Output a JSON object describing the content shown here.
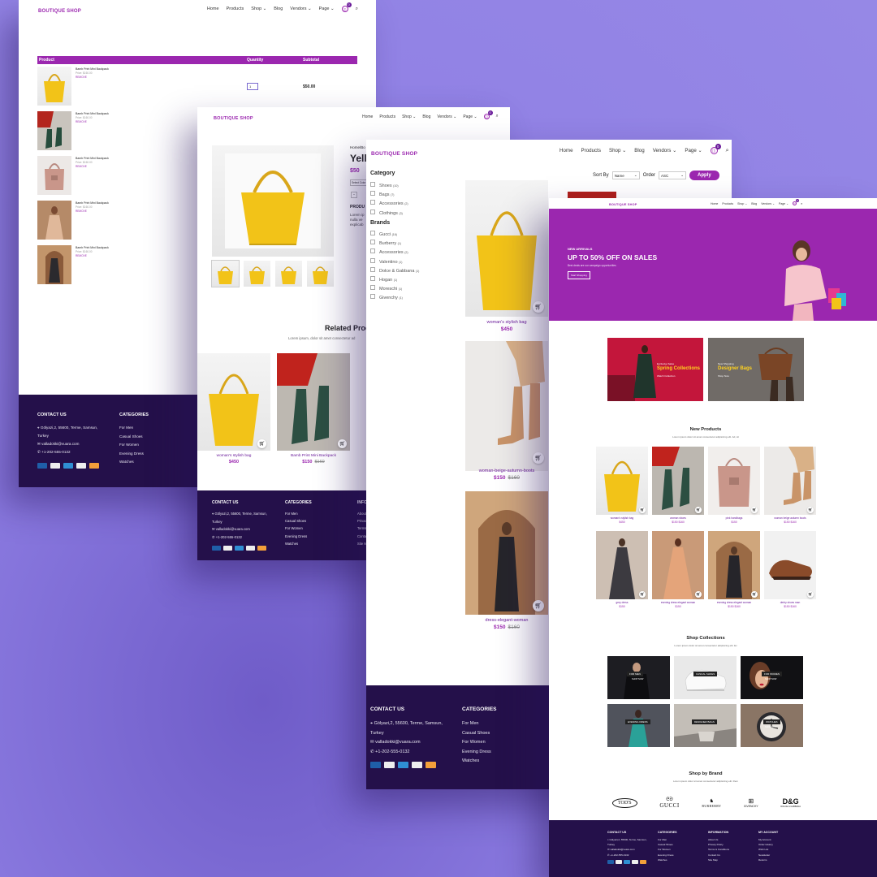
{
  "brand": "BOUTIQUE SHOP",
  "nav": {
    "home": "Home",
    "products": "Products",
    "shop": "Shop",
    "blog": "Blog",
    "vendors": "Vendors",
    "page": "Page",
    "cart_count": "0"
  },
  "cart": {
    "headers": {
      "product": "Product",
      "quantity": "Quantity",
      "subtotal": "Subtotal"
    },
    "items": [
      {
        "name": "Bamb Print Mini Backpack",
        "price": "Price: $160.00",
        "remove": "REMOVE"
      },
      {
        "name": "Bamb Print Mini Backpack",
        "price": "Price: $160.00",
        "remove": "REMOVE"
      },
      {
        "name": "Bamb Print Mini Backpack",
        "price": "Price: $160.00",
        "remove": "REMOVE"
      },
      {
        "name": "Bamb Print Mini Backpack",
        "price": "Price: $160.00",
        "remove": "REMOVE"
      },
      {
        "name": "Bamb Print Mini Backpack",
        "price": "Price: $160.00",
        "remove": "REMOVE"
      }
    ],
    "quantity": "1",
    "subtotal": "$50.00"
  },
  "footer": {
    "contact_title": "CONTACT US",
    "address_line1": "Gölyazi,2, 55600, Terme, Samsun,",
    "address_line2": "Turkey",
    "email": "valladokki@vuara.com",
    "phone": "+1-202-555-0132",
    "categories_title": "CATEGORIES",
    "categories": [
      "For Men",
      "Casual Shoes",
      "For Women",
      "Evening Dress",
      "Watches"
    ],
    "info_title": "INFORMATION",
    "info_links": [
      "About Us",
      "Privacy Policy",
      "Terms & Conditions",
      "Contact Us",
      "Site Map"
    ],
    "account_title": "MY ACCOUNT",
    "account_links": [
      "My Account",
      "Order History",
      "Wish List",
      "Newsletter",
      "Returns"
    ],
    "payments": [
      "maestro",
      "paypal",
      "amex",
      "visa",
      "mastercard"
    ]
  },
  "detail": {
    "breadcrumb": "Home/Bo",
    "title": "Yell",
    "price": "$50",
    "select": "Select Color",
    "product_label": "PRODU",
    "desc1": "Lorem ip",
    "desc2": "nulla ve",
    "desc3": "explicab",
    "related_title": "Related Prod",
    "related_sub": "Lorem ipsum, dolor sit amet consectetur ad",
    "related": [
      {
        "name": "woman's stylish bag",
        "price": "$450",
        "old": ""
      },
      {
        "name": "Bamb Print Mini Backpack",
        "price": "$150",
        "old": "$160"
      }
    ]
  },
  "listing": {
    "category_title": "Category",
    "categories": [
      {
        "name": "Shoes",
        "count": "(10)"
      },
      {
        "name": "Bags",
        "count": "(7)"
      },
      {
        "name": "Accessories",
        "count": "(2)"
      },
      {
        "name": "Clothings",
        "count": "(3)"
      }
    ],
    "brands_title": "Brands",
    "brands": [
      {
        "name": "Gucci",
        "count": "(16)"
      },
      {
        "name": "Burberry",
        "count": "(1)"
      },
      {
        "name": "Accessories",
        "count": "(2)"
      },
      {
        "name": "Valentino",
        "count": "(1)"
      },
      {
        "name": "Dolce & Gabbana",
        "count": "(1)"
      },
      {
        "name": "Hogan",
        "count": "(1)"
      },
      {
        "name": "Moreschi",
        "count": "(1)"
      },
      {
        "name": "Givenchy",
        "count": "(1)"
      }
    ],
    "sort_label": "Sort By",
    "sort_value": "Name",
    "order_label": "Order",
    "order_value": "ASC",
    "apply": "Apply",
    "products": [
      {
        "name": "woman's stylish bag",
        "price": "$450",
        "old": ""
      },
      {
        "name": "woman-beige-autumn-boots",
        "price": "$150",
        "old": "$160"
      },
      {
        "name": "dress-elegant-woman",
        "price": "$150",
        "old": "$160"
      }
    ]
  },
  "home": {
    "hero_kicker": "NEW ARRIVALS",
    "hero_title": "UP TO 50% OFF ON SALES",
    "hero_sub": "Best deals are our campaign opportunities",
    "hero_button": "Start Shopping",
    "promo1_kicker": "Exclusive Sales",
    "promo1_title": "Spring Collections",
    "promo1_link": "Watch Collection",
    "promo2_kicker": "New Shopping",
    "promo2_title": "Designer Bags",
    "promo2_link": "Shop Now",
    "new_title": "New Products",
    "new_sub": "Lorem ipsum dolor sit amet consectetur adipisicing elit. Ad, sit",
    "new_products": [
      {
        "name": "woman's stylish bag",
        "price": "$450"
      },
      {
        "name": "woman shoes",
        "price": "$150 $160"
      },
      {
        "name": "pink handbags",
        "price": "$150"
      },
      {
        "name": "woman beige autumn boots",
        "price": "$150 $160"
      },
      {
        "name": "grey dress",
        "price": "$150"
      },
      {
        "name": "evening dress elegant woman",
        "price": "$150"
      },
      {
        "name": "evening dress elegant woman",
        "price": "$150 $160"
      },
      {
        "name": "derby shoes man",
        "price": "$150 $160"
      }
    ],
    "collections_title": "Shop Collections",
    "collections_sub": "Lorem ipsum dolor sit amet consectetur adipisicing elit. Ex",
    "collections": [
      {
        "label": "FOR MEN",
        "cta": "SHOP NOW"
      },
      {
        "label": "CASUAL SHOES",
        "cta": ""
      },
      {
        "label": "FOR WOMEN",
        "cta": "SHOP NOW"
      },
      {
        "label": "EVENING DRESS",
        "cta": ""
      },
      {
        "label": "DESIGNER BAGS",
        "cta": ""
      },
      {
        "label": "WATCHES",
        "cta": "SHOP NOW"
      }
    ],
    "brands_title": "Shop by Brand",
    "brands_sub": "Lorem ipsum dolor sit amet consectetur adipisicing elit. Rem",
    "brand_logos": [
      "TOD'S",
      "GUCCI",
      "BURBERRY",
      "GIVENCHY",
      "D&G"
    ],
    "brand_logo_subs": [
      "",
      "",
      "",
      "",
      "DOLCE & GABBANA"
    ]
  }
}
